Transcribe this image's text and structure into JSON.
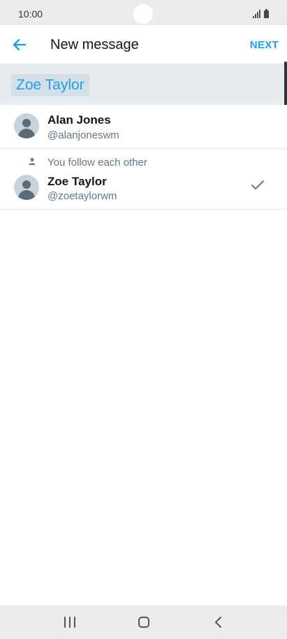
{
  "status_bar": {
    "time": "10:00"
  },
  "header": {
    "title": "New message",
    "next_label": "NEXT"
  },
  "recipients": {
    "chips": [
      "Zoe Taylor"
    ]
  },
  "users": [
    {
      "name": "Alan Jones",
      "handle": "@alanjoneswm",
      "note": "",
      "selected": false
    },
    {
      "name": "Zoe Taylor",
      "handle": "@zoetaylorwm",
      "note": "You follow each other",
      "selected": true
    }
  ],
  "colors": {
    "accent": "#1da1f2",
    "recipient_bar": "#e6ecf0",
    "secondary_text": "#657786"
  },
  "icons": {
    "back": "arrow-left-icon",
    "follow": "person-icon",
    "selected": "checkmark-icon",
    "nav_recent": "recent-apps-icon",
    "nav_home": "home-icon",
    "nav_back": "back-chevron-icon"
  }
}
